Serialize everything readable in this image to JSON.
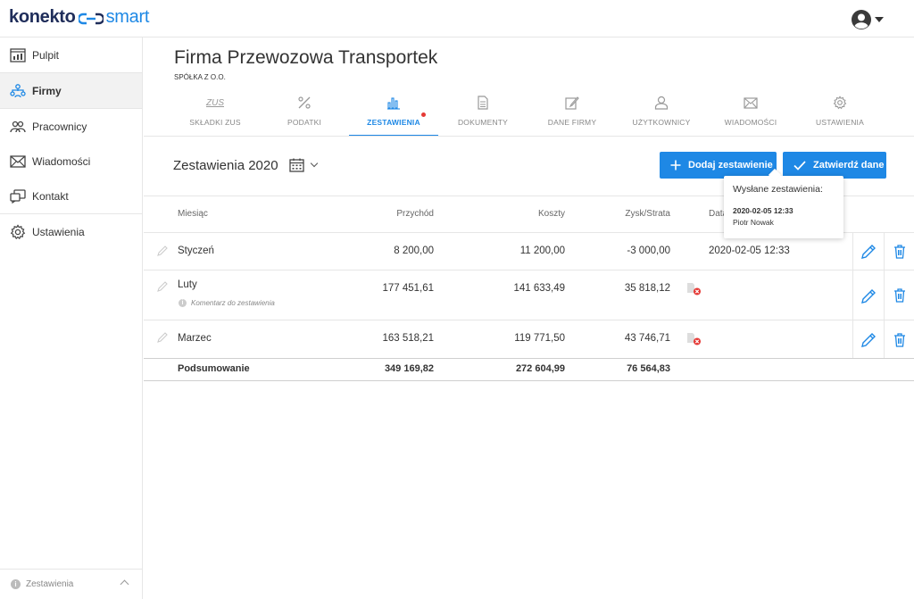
{
  "brand": {
    "part1": "konekto",
    "part2": "smart",
    "accent": "#1e88e5",
    "dark": "#1f2d5a"
  },
  "sidebar": {
    "items": [
      {
        "label": "Pulpit",
        "icon": "dashboard-icon"
      },
      {
        "label": "Firmy",
        "icon": "companies-icon",
        "active": true
      },
      {
        "label": "Pracownicy",
        "icon": "employees-icon"
      },
      {
        "label": "Wiadomości",
        "icon": "envelope-icon"
      },
      {
        "label": "Kontakt",
        "icon": "contact-icon"
      },
      {
        "label": "Ustawienia",
        "icon": "gear-icon"
      }
    ],
    "footer_label": "Zestawienia"
  },
  "company": {
    "name": "Firma Przewozowa Transportek",
    "subtitle": "SPÓŁKA Z O.O."
  },
  "tabs": [
    {
      "label": "SKŁADKI ZUS",
      "icon": "zus-icon",
      "icon_text": "ZUS"
    },
    {
      "label": "PODATKI",
      "icon": "percent-icon"
    },
    {
      "label": "ZESTAWIENIA",
      "icon": "bar-chart-icon",
      "active": true,
      "notification": true
    },
    {
      "label": "DOKUMENTY",
      "icon": "document-icon"
    },
    {
      "label": "DANE FIRMY",
      "icon": "edit-icon"
    },
    {
      "label": "UŻYTKOWNICY",
      "icon": "user-icon"
    },
    {
      "label": "WIADOMOŚCI",
      "icon": "envelope-icon"
    },
    {
      "label": "USTAWIENIA",
      "icon": "gear-icon"
    }
  ],
  "section": {
    "title": "Zestawienia 2020"
  },
  "buttons": {
    "add": "Dodaj zestawienie",
    "confirm": "Zatwierdź dane"
  },
  "table": {
    "headers": {
      "month": "Miesiąc",
      "income": "Przychód",
      "costs": "Koszty",
      "profit": "Zysk/Strata",
      "date": "Data"
    },
    "rows": [
      {
        "month": "Styczeń",
        "income": "8 200,00",
        "costs": "11 200,00",
        "profit": "-3 000,00",
        "date": "2020-02-05 12:33"
      },
      {
        "month": "Luty",
        "income": "177 451,61",
        "costs": "141 633,49",
        "profit": "35 818,12",
        "date": "",
        "comment": "Komentarz do zestawienia"
      },
      {
        "month": "Marzec",
        "income": "163 518,21",
        "costs": "119 771,50",
        "profit": "43 746,71",
        "date": ""
      }
    ],
    "summary": {
      "label": "Podsumowanie",
      "income": "349 169,82",
      "costs": "272 604,99",
      "profit": "76 564,83"
    }
  },
  "tooltip": {
    "title": "Wysłane zestawienia:",
    "date": "2020-02-05 12:33",
    "user": "Piotr Nowak"
  }
}
